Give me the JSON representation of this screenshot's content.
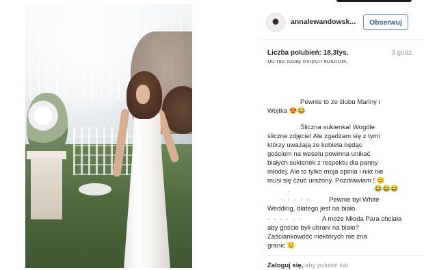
{
  "post": {
    "username": "annalewandowsk...",
    "follow_label": "Obserwuj",
    "likes_label": "Liczba polubień:",
    "likes_value": "18,3tys.",
    "time_ago": "3 godz."
  },
  "comments": {
    "partial_top": "bo nie lubię innych kolorów.",
    "c1_l1": "Pewnie to ze ślubu Mariny i",
    "c1_l2": "Wojtka 😍😂",
    "c2_l1": "Śliczna sukienka! Wogóle",
    "c2_l2": "śliczne zdjęcie! Ale zgadzam się z tymi",
    "c2_l3": "którzy uważają że kobieta będąc",
    "c2_l4": "gościem na weselu powinna unikać",
    "c2_l5": "białych sukienek z respektu dla panny",
    "c2_l6": "młodej. Ale to tylko moja opinia i nikt nie",
    "c2_l7": "musi się czuć urażony. Pozdrawiam ! 😊",
    "c3_emojis": "😂😂😂",
    "c4_l1": "Pewnie był White",
    "c4_l2": "Wedding, dlatego jest na biało.",
    "c5_l1": "A może Młoda Para chciała",
    "c5_l2": "aby goście byli ubrani na biało?",
    "c5_l3": "Zaściankowość niektórych nie zna",
    "c5_l4": "granic 😟"
  },
  "footer": {
    "login_link": "Zaloguj się,",
    "login_rest": " aby polubić lub"
  },
  "colors": {
    "follow_border": "#6b93b8",
    "follow_text": "#2e5e8e",
    "muted": "#999999"
  }
}
